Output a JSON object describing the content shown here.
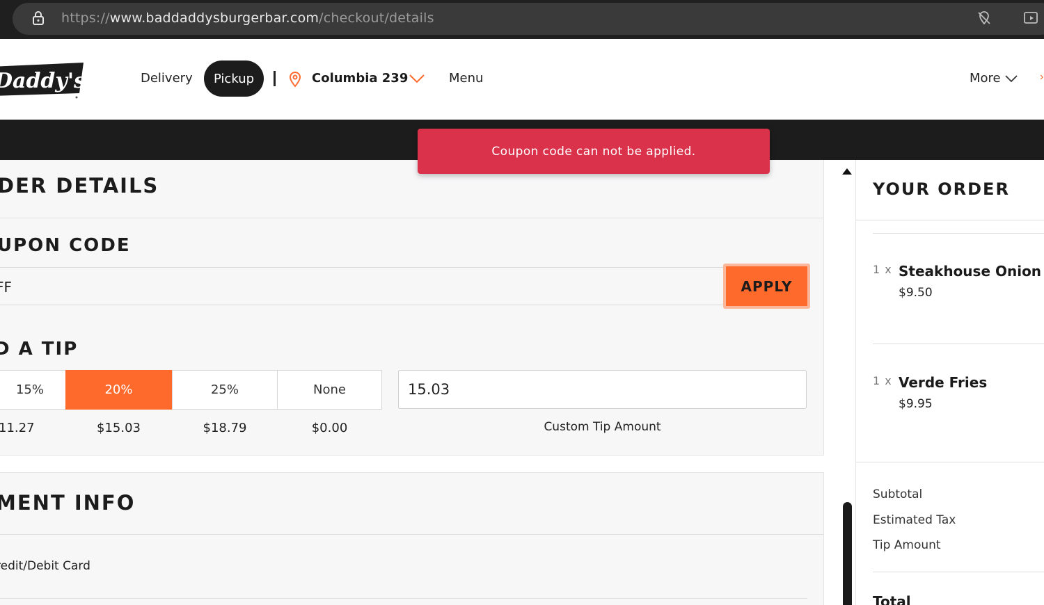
{
  "browser": {
    "url_scheme": "https://",
    "url_host": "www.baddaddysburgerbar.com",
    "url_path": "/checkout/details"
  },
  "header": {
    "logo_text": "Daddy's",
    "nav": {
      "delivery": "Delivery",
      "pickup": "Pickup",
      "location": "Columbia 239",
      "menu": "Menu",
      "more": "More"
    }
  },
  "toast": {
    "message": "Coupon code can not be applied."
  },
  "order_details": {
    "title": "DER DETAILS",
    "coupon": {
      "title": "UPON CODE",
      "value": "FF",
      "apply_label": "APPLY"
    },
    "tip": {
      "title": "D A TIP",
      "options": [
        {
          "label": "15%",
          "amount": "11.27"
        },
        {
          "label": "20%",
          "amount": "$15.03"
        },
        {
          "label": "25%",
          "amount": "$18.79"
        },
        {
          "label": "None",
          "amount": "$0.00"
        }
      ],
      "selected": "20%",
      "custom_value": "15.03",
      "custom_label": "Custom Tip Amount"
    }
  },
  "payment": {
    "title": "MENT INFO",
    "method": "redit/Debit Card"
  },
  "your_order": {
    "title": "YOUR ORDER",
    "items": [
      {
        "qty": "1 x",
        "name": "Steakhouse Onion R",
        "price": "$9.50"
      },
      {
        "qty": "1 x",
        "name": "Verde Fries",
        "price": "$9.95"
      }
    ],
    "summary": {
      "subtotal": "Subtotal",
      "tax": "Estimated Tax",
      "tip": "Tip Amount",
      "total": "Total"
    }
  },
  "colors": {
    "accent": "#fd6a2c",
    "toast": "#d9324a",
    "dark": "#1c1c1c"
  }
}
